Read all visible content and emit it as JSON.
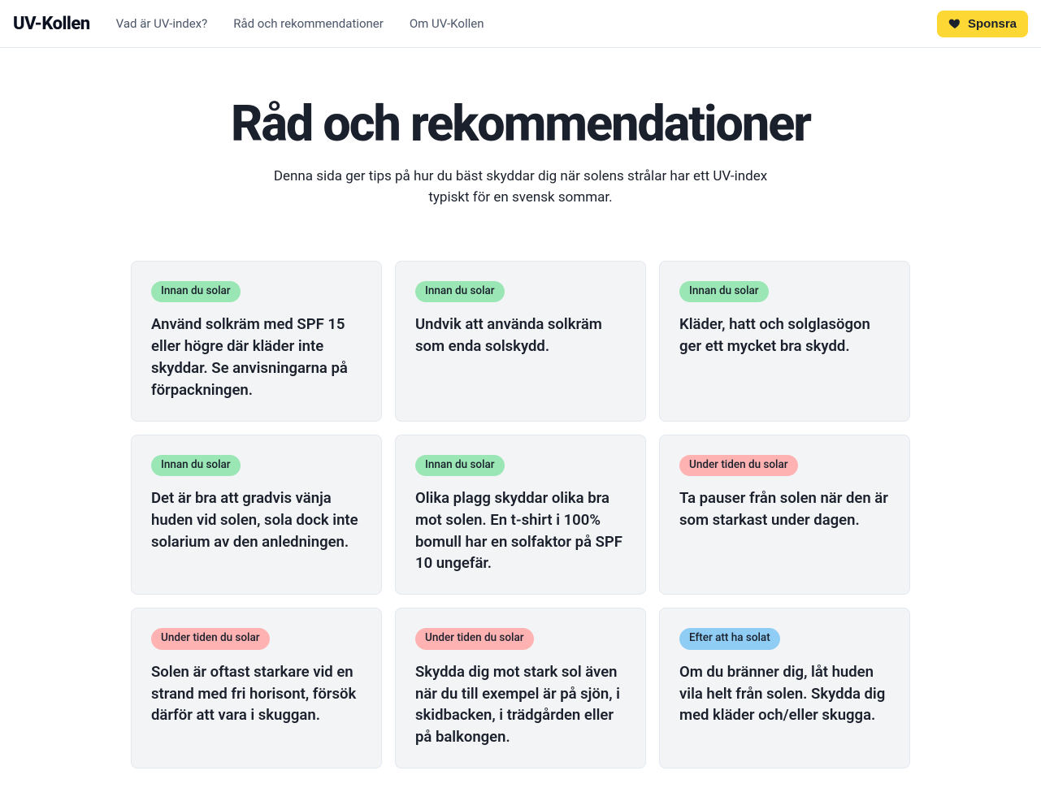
{
  "header": {
    "brand": "UV-Kollen",
    "nav": [
      "Vad är UV-index?",
      "Råd och rekommendationer",
      "Om UV-Kollen"
    ],
    "sponsor_label": "Sponsra"
  },
  "hero": {
    "title": "Råd och rekommendationer",
    "subtitle": "Denna sida ger tips på hur du bäst skyddar dig när solens strålar har ett UV-index typiskt för en svensk sommar."
  },
  "badges": {
    "before": "Innan du solar",
    "during": "Under tiden du solar",
    "after": "Efter att ha solat"
  },
  "cards": [
    {
      "phase": "before",
      "text": "Använd solkräm med SPF 15 eller högre där kläder inte skyddar. Se anvisningarna på förpackningen."
    },
    {
      "phase": "before",
      "text": "Undvik att använda solkräm som enda solskydd."
    },
    {
      "phase": "before",
      "text": "Kläder, hatt och solglasögon ger ett mycket bra skydd."
    },
    {
      "phase": "before",
      "text": "Det är bra att gradvis vänja huden vid solen, sola dock inte solarium av den anledningen."
    },
    {
      "phase": "before",
      "text": "Olika plagg skyddar olika bra mot solen. En t-shirt i 100% bomull har en solfaktor på SPF 10 ungefär."
    },
    {
      "phase": "during",
      "text": "Ta pauser från solen när den är som starkast under dagen."
    },
    {
      "phase": "during",
      "text": "Solen är oftast starkare vid en strand med fri horisont, försök därför att vara i skuggan."
    },
    {
      "phase": "during",
      "text": "Skydda dig mot stark sol även när du till exempel är på sjön, i skidbacken, i trädgården eller på balkongen."
    },
    {
      "phase": "after",
      "text": "Om du bränner dig, låt huden vila helt från solen. Skydda dig med kläder och/eller skugga."
    }
  ]
}
